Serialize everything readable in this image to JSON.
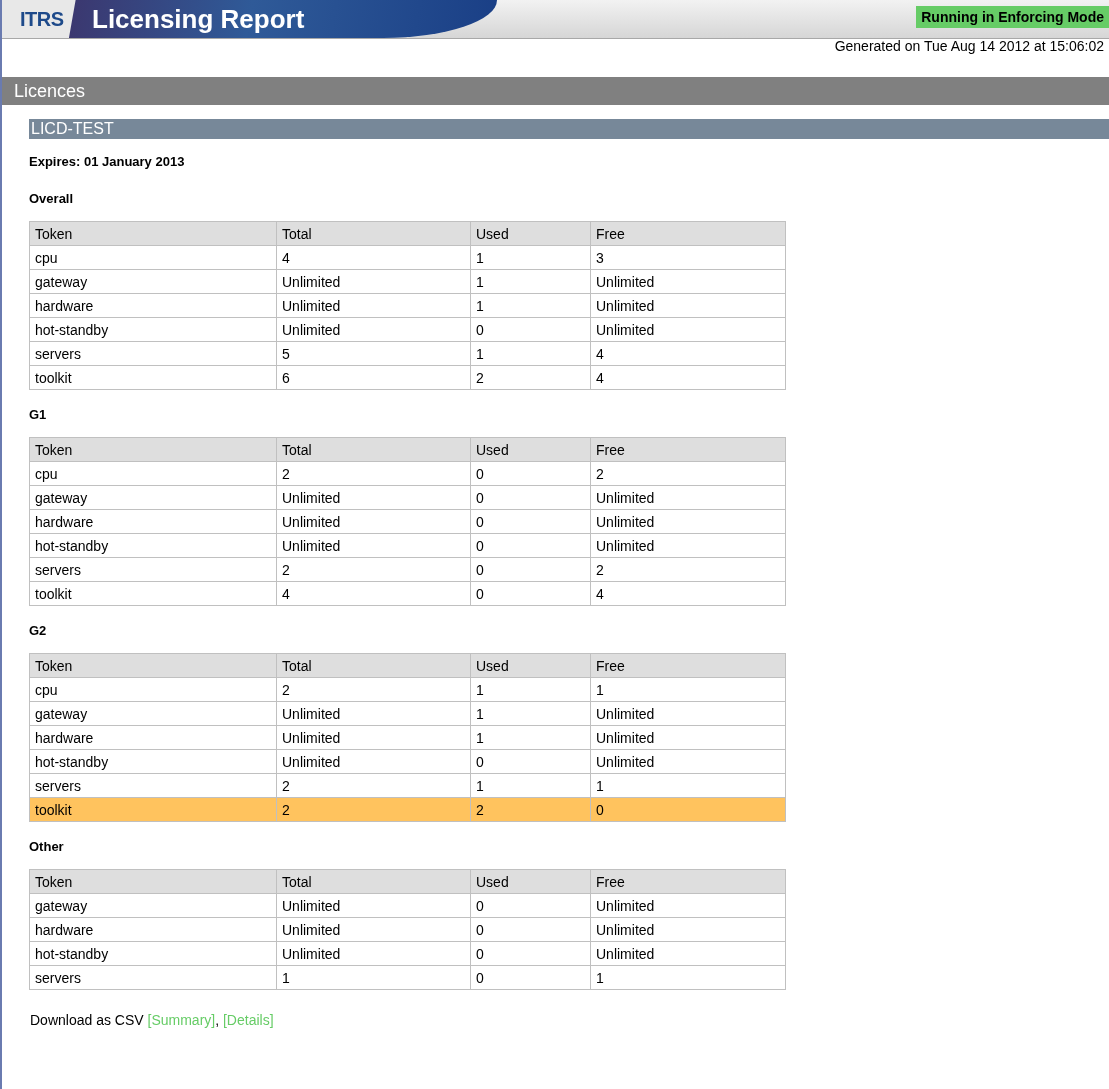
{
  "header": {
    "logo": "ITRS",
    "title": "Licensing Report",
    "mode_badge": "Running in Enforcing Mode"
  },
  "generated": "Generated on Tue Aug 14 2012 at 15:06:02",
  "section_title": "Licences",
  "licence": {
    "name": "LICD-TEST",
    "expires": "Expires: 01 January 2013",
    "groups": [
      {
        "title": "Overall",
        "columns": [
          "Token",
          "Total",
          "Used",
          "Free"
        ],
        "rows": [
          {
            "cells": [
              "cpu",
              "4",
              "1",
              "3"
            ],
            "highlighted": false
          },
          {
            "cells": [
              "gateway",
              "Unlimited",
              "1",
              "Unlimited"
            ],
            "highlighted": false
          },
          {
            "cells": [
              "hardware",
              "Unlimited",
              "1",
              "Unlimited"
            ],
            "highlighted": false
          },
          {
            "cells": [
              "hot-standby",
              "Unlimited",
              "0",
              "Unlimited"
            ],
            "highlighted": false
          },
          {
            "cells": [
              "servers",
              "5",
              "1",
              "4"
            ],
            "highlighted": false
          },
          {
            "cells": [
              "toolkit",
              "6",
              "2",
              "4"
            ],
            "highlighted": false
          }
        ]
      },
      {
        "title": "G1",
        "columns": [
          "Token",
          "Total",
          "Used",
          "Free"
        ],
        "rows": [
          {
            "cells": [
              "cpu",
              "2",
              "0",
              "2"
            ],
            "highlighted": false
          },
          {
            "cells": [
              "gateway",
              "Unlimited",
              "0",
              "Unlimited"
            ],
            "highlighted": false
          },
          {
            "cells": [
              "hardware",
              "Unlimited",
              "0",
              "Unlimited"
            ],
            "highlighted": false
          },
          {
            "cells": [
              "hot-standby",
              "Unlimited",
              "0",
              "Unlimited"
            ],
            "highlighted": false
          },
          {
            "cells": [
              "servers",
              "2",
              "0",
              "2"
            ],
            "highlighted": false
          },
          {
            "cells": [
              "toolkit",
              "4",
              "0",
              "4"
            ],
            "highlighted": false
          }
        ]
      },
      {
        "title": "G2",
        "columns": [
          "Token",
          "Total",
          "Used",
          "Free"
        ],
        "rows": [
          {
            "cells": [
              "cpu",
              "2",
              "1",
              "1"
            ],
            "highlighted": false
          },
          {
            "cells": [
              "gateway",
              "Unlimited",
              "1",
              "Unlimited"
            ],
            "highlighted": false
          },
          {
            "cells": [
              "hardware",
              "Unlimited",
              "1",
              "Unlimited"
            ],
            "highlighted": false
          },
          {
            "cells": [
              "hot-standby",
              "Unlimited",
              "0",
              "Unlimited"
            ],
            "highlighted": false
          },
          {
            "cells": [
              "servers",
              "2",
              "1",
              "1"
            ],
            "highlighted": false
          },
          {
            "cells": [
              "toolkit",
              "2",
              "2",
              "0"
            ],
            "highlighted": true
          }
        ]
      },
      {
        "title": "Other",
        "columns": [
          "Token",
          "Total",
          "Used",
          "Free"
        ],
        "rows": [
          {
            "cells": [
              "gateway",
              "Unlimited",
              "0",
              "Unlimited"
            ],
            "highlighted": false
          },
          {
            "cells": [
              "hardware",
              "Unlimited",
              "0",
              "Unlimited"
            ],
            "highlighted": false
          },
          {
            "cells": [
              "hot-standby",
              "Unlimited",
              "0",
              "Unlimited"
            ],
            "highlighted": false
          },
          {
            "cells": [
              "servers",
              "1",
              "0",
              "1"
            ],
            "highlighted": false
          }
        ]
      }
    ]
  },
  "download": {
    "text": "Download as CSV",
    "links": [
      "[Summary]",
      "[Details]"
    ],
    "separator": ","
  }
}
